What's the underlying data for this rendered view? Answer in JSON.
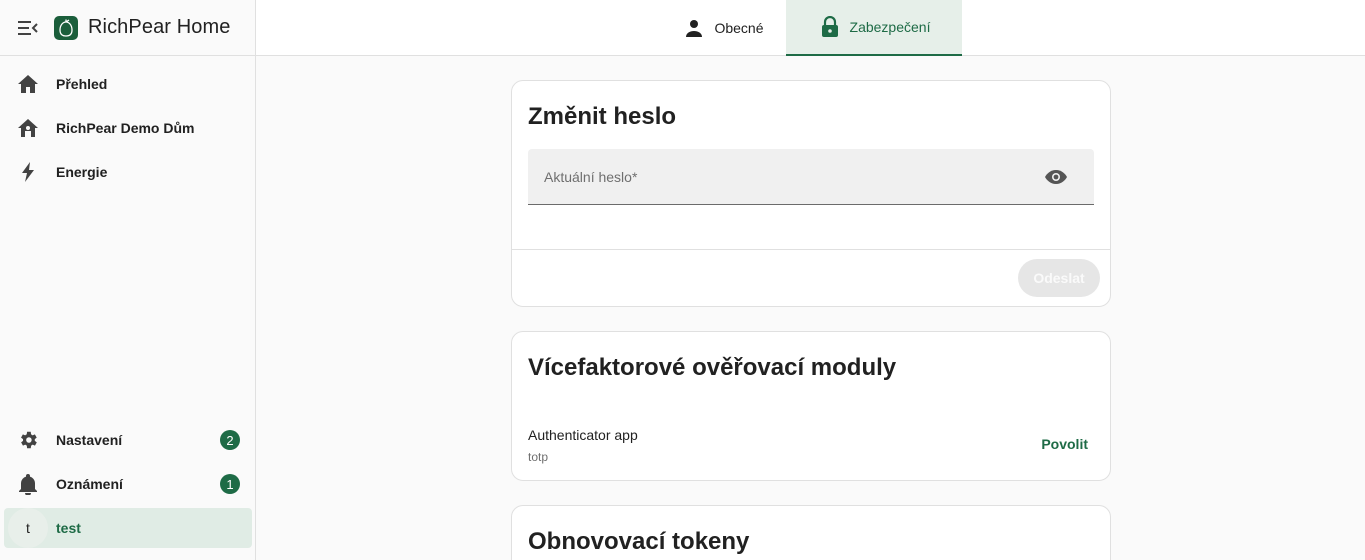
{
  "app": {
    "title": "RichPear Home"
  },
  "sidebar": {
    "items": [
      {
        "label": "Přehled",
        "icon": "home-icon"
      },
      {
        "label": "RichPear Demo Dům",
        "icon": "home-group-icon"
      },
      {
        "label": "Energie",
        "icon": "lightning-bolt-icon"
      }
    ],
    "bottom_items": [
      {
        "label": "Nastavení",
        "icon": "gear-icon",
        "badge": "2"
      },
      {
        "label": "Oznámení",
        "icon": "bell-icon",
        "badge": "1"
      }
    ],
    "user": {
      "avatar_letter": "t",
      "name": "test"
    }
  },
  "tabs": [
    {
      "label": "Obecné",
      "icon": "account-icon",
      "active": false
    },
    {
      "label": "Zabezpečení",
      "icon": "lock-icon",
      "active": true
    }
  ],
  "change_password": {
    "title": "Změnit heslo",
    "current_password_placeholder": "Aktuální heslo*",
    "submit_label": "Odeslat"
  },
  "mfa": {
    "title": "Vícefaktorové ověřovací moduly",
    "modules": [
      {
        "name": "Authenticator app",
        "id": "totp",
        "action": "Povolit"
      }
    ]
  },
  "refresh_tokens": {
    "title": "Obnovovací tokeny"
  },
  "colors": {
    "accent": "#1e6b46",
    "active_tab_bg": "#e6efe9",
    "page_bg": "#fafafa"
  }
}
